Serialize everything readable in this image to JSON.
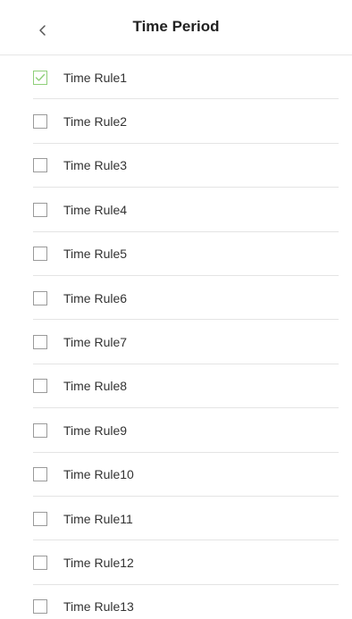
{
  "header": {
    "title": "Time Period"
  },
  "colors": {
    "check_green": "#8fcf7a",
    "checkbox_border": "#9a9a9a",
    "divider": "#e4e4e4"
  },
  "icons": {
    "back": "chevron-left-icon",
    "check": "checkmark-icon"
  },
  "rules": [
    {
      "label": "Time Rule1",
      "checked": true
    },
    {
      "label": "Time Rule2",
      "checked": false
    },
    {
      "label": "Time Rule3",
      "checked": false
    },
    {
      "label": "Time Rule4",
      "checked": false
    },
    {
      "label": "Time Rule5",
      "checked": false
    },
    {
      "label": "Time Rule6",
      "checked": false
    },
    {
      "label": "Time Rule7",
      "checked": false
    },
    {
      "label": "Time Rule8",
      "checked": false
    },
    {
      "label": "Time Rule9",
      "checked": false
    },
    {
      "label": "Time Rule10",
      "checked": false
    },
    {
      "label": "Time Rule11",
      "checked": false
    },
    {
      "label": "Time Rule12",
      "checked": false
    },
    {
      "label": "Time Rule13",
      "checked": false
    }
  ]
}
